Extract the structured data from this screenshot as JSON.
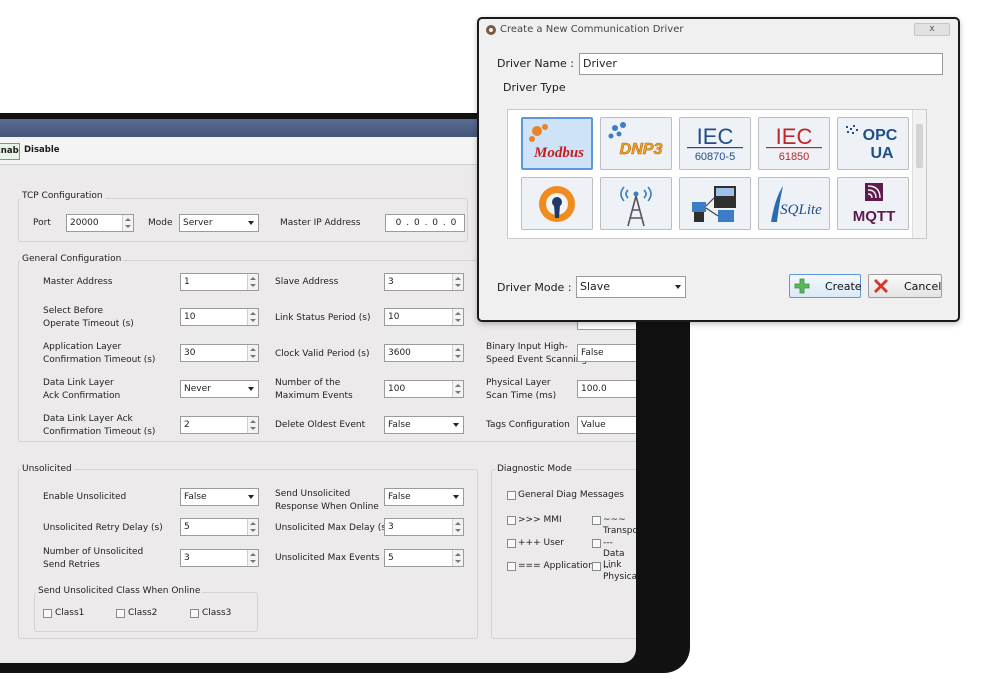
{
  "main": {
    "toolbar": {
      "enable_label": "Enable",
      "disable_label": "Disable"
    },
    "tcp": {
      "title": "TCP Configuration",
      "port_label": "Port",
      "port_value": "20000",
      "mode_label": "Mode",
      "mode_value": "Server",
      "master_ip_label": "Master IP Address",
      "master_ip_value": "0 . 0 . 0 . 0"
    },
    "general": {
      "title": "General Configuration",
      "master_address_label": "Master Address",
      "master_address_value": "1",
      "slave_address_label": "Slave Address",
      "slave_address_value": "3",
      "select_before_label_1": "Select Before",
      "select_before_label_2": "Operate Timeout (s)",
      "select_before_value": "10",
      "link_status_label": "Link Status Period (s)",
      "link_status_value": "10",
      "app_layer_label_1": "Application Layer",
      "app_layer_label_2": "Confirmation Timeout (s)",
      "app_layer_value": "30",
      "clock_valid_label": "Clock Valid Period (s)",
      "clock_valid_value": "3600",
      "binary_input_label_1": "Binary Input High-",
      "binary_input_label_2": "Speed Event Scanning",
      "binary_input_value": "False",
      "data_link_label_1": "Data Link Layer",
      "data_link_label_2": "Ack Confirmation",
      "data_link_value": "Never",
      "max_events_label_1": "Number of the",
      "max_events_label_2": "Maximum Events",
      "max_events_value": "100",
      "physical_layer_label_1": "Physical Layer",
      "physical_layer_label_2": "Scan Time (ms)",
      "physical_layer_value": "100.0",
      "dl_ack_timeout_label_1": "Data Link Layer Ack",
      "dl_ack_timeout_label_2": "Confirmation Timeout (s)",
      "dl_ack_timeout_value": "2",
      "delete_oldest_label": "Delete Oldest Event",
      "delete_oldest_value": "False",
      "tags_config_label": "Tags Configuration",
      "tags_config_value": "Value"
    },
    "unsolicited": {
      "title": "Unsolicited",
      "enable_label": "Enable Unsolicited",
      "enable_value": "False",
      "send_online_label_1": "Send Unsolicited",
      "send_online_label_2": "Response When Online",
      "send_online_value": "False",
      "retry_delay_label": "Unsolicited Retry Delay (s)",
      "retry_delay_value": "5",
      "max_delay_label": "Unsolicited Max Delay (s)",
      "max_delay_value": "3",
      "send_retries_label_1": "Number of Unsolicited",
      "send_retries_label_2": "Send Retries",
      "send_retries_value": "3",
      "max_events_label": "Unsolicited Max Events",
      "max_events_value": "5",
      "class_group_title": "Send Unsolicited Class When Online",
      "class1": "Class1",
      "class2": "Class2",
      "class3": "Class3"
    },
    "diagnostic": {
      "title": "Diagnostic Mode",
      "general": "General Diag Messages",
      "mmi": ">>> MMI",
      "transport": "~~~ Transport",
      "user": "+++ User",
      "data_link": "--- Data Link",
      "application": "=== Application",
      "physical": "... Physical"
    }
  },
  "dialog": {
    "title": "Create a New Communication Driver",
    "close_label": "x",
    "driver_name_label": "Driver Name :",
    "driver_name_value": "Driver",
    "driver_type_label": "Driver Type",
    "tiles": [
      {
        "name": "Modbus",
        "icon": "modbus-logo"
      },
      {
        "name": "DNP3",
        "icon": "dnp3-logo"
      },
      {
        "name": "IEC 60870-5",
        "line1": "IEC",
        "line2": "60870-5",
        "icon": "iec-60870-logo"
      },
      {
        "name": "IEC 61850",
        "line1": "IEC",
        "line2": "61850",
        "icon": "iec-61850-logo"
      },
      {
        "name": "OPC UA",
        "line1": "OPC",
        "line2": "UA",
        "icon": "opc-ua-logo"
      },
      {
        "name": "OpenVPN",
        "icon": "openvpn-logo"
      },
      {
        "name": "Wireless tower",
        "icon": "tower-icon"
      },
      {
        "name": "Network devices",
        "icon": "network-devices-icon"
      },
      {
        "name": "SQLite",
        "icon": "sqlite-logo"
      },
      {
        "name": "MQTT",
        "icon": "mqtt-logo"
      }
    ],
    "driver_mode_label": "Driver Mode :",
    "driver_mode_value": "Slave",
    "create_label": "Create",
    "cancel_label": "Cancel",
    "colors": {
      "selection": "#5d97d6",
      "iec_blue": "#1f4f8a",
      "iec_red": "#c0262c",
      "mqtt_purple": "#5d1b4e"
    }
  }
}
